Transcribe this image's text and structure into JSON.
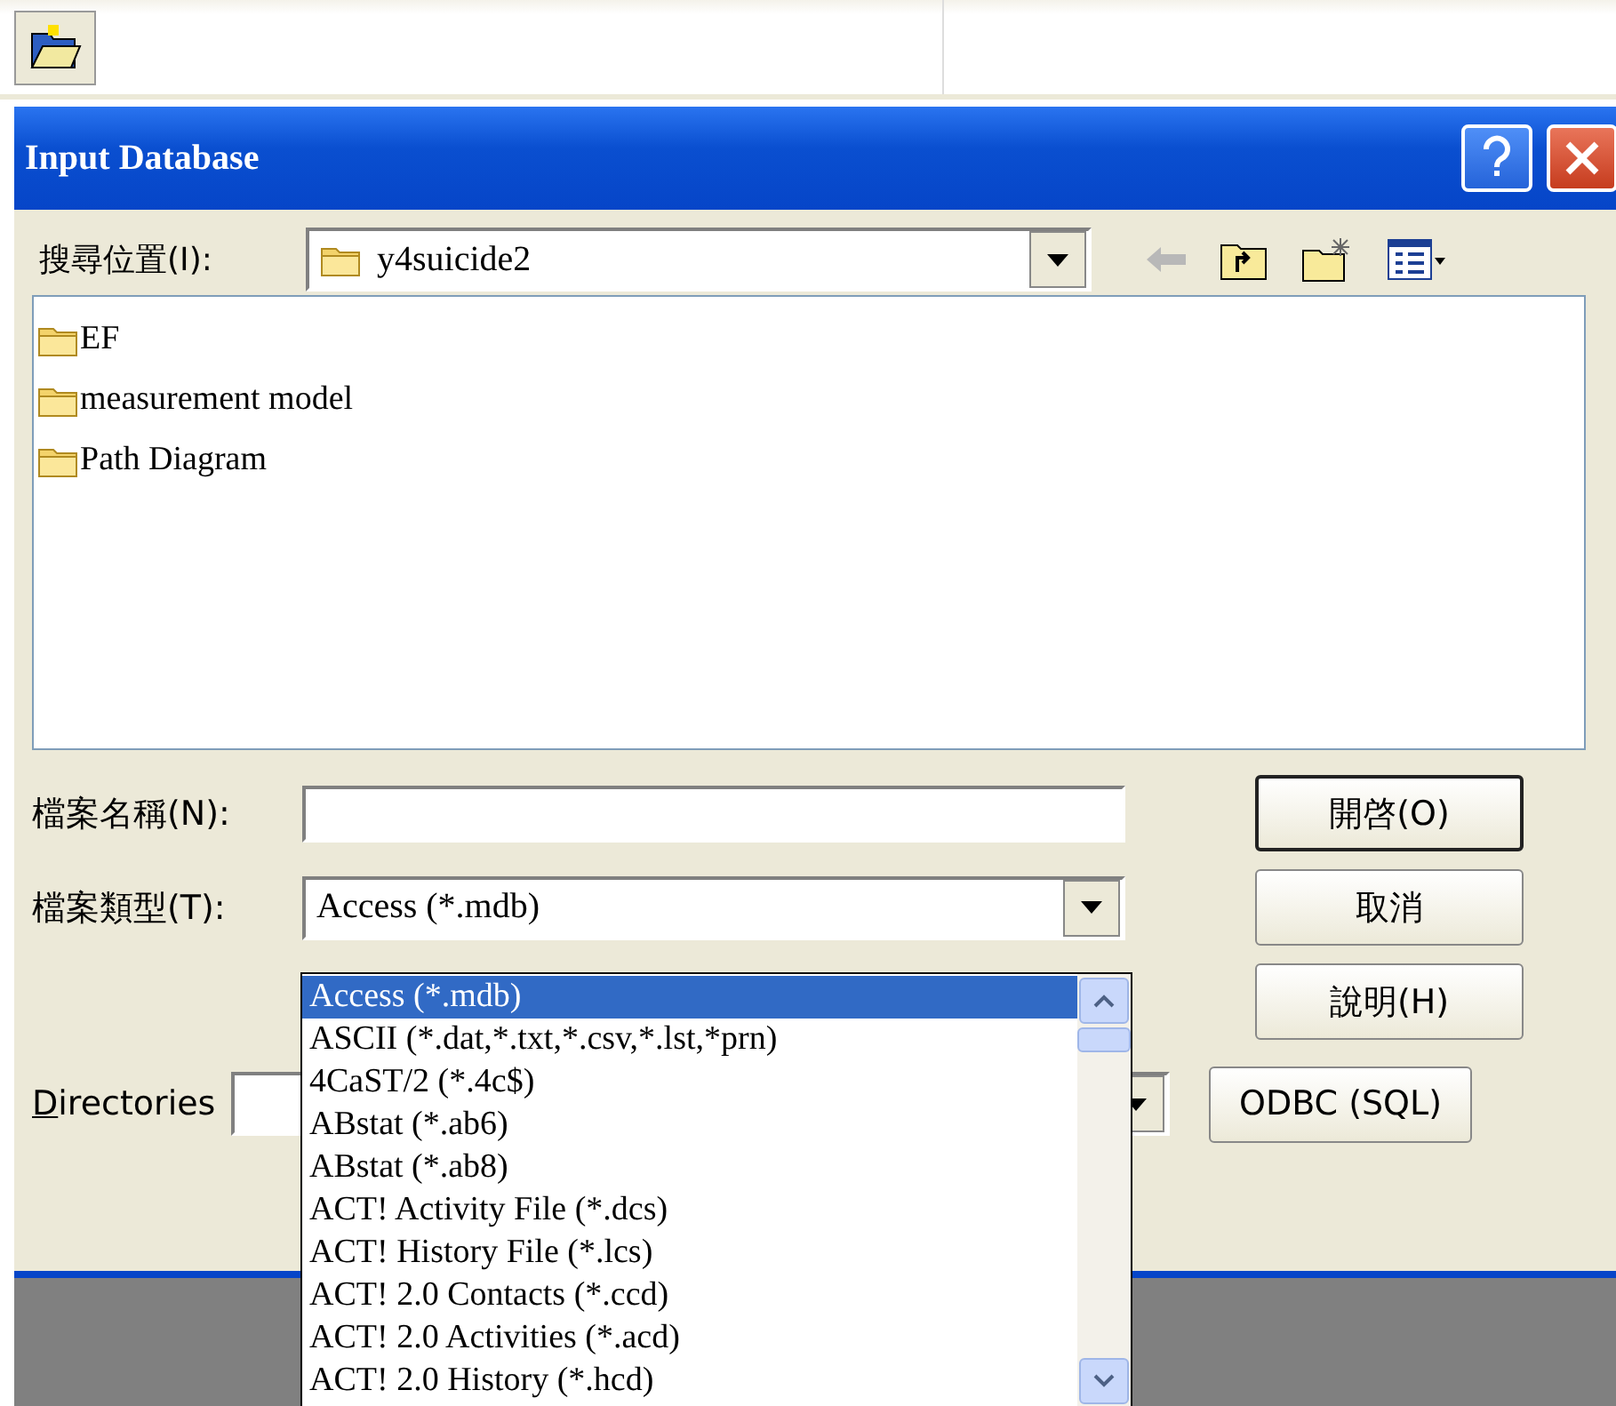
{
  "window": {
    "title": "Input Database"
  },
  "look_in": {
    "label": "搜尋位置(I):",
    "value": "y4suicide2"
  },
  "files": [
    {
      "name": "EF"
    },
    {
      "name": "measurement model"
    },
    {
      "name": "Path Diagram"
    }
  ],
  "file_name": {
    "label": "檔案名稱(N):"
  },
  "file_type": {
    "label": "檔案類型(T):",
    "value": "Access (*.mdb)",
    "expanded": true,
    "options": [
      {
        "label": "Access (*.mdb)",
        "selected": true
      },
      {
        "label": "ASCII (*.dat,*.txt,*.csv,*.lst,*prn)",
        "selected": false
      },
      {
        "label": "4CaST/2 (*.4c$)",
        "selected": false
      },
      {
        "label": "ABstat (*.ab6)",
        "selected": false
      },
      {
        "label": "ABstat (*.ab8)",
        "selected": false
      },
      {
        "label": "ACT! Activity File (*.dcs)",
        "selected": false
      },
      {
        "label": "ACT! History File (*.lcs)",
        "selected": false
      },
      {
        "label": "ACT! 2.0 Contacts (*.ccd)",
        "selected": false
      },
      {
        "label": "ACT! 2.0 Activities (*.acd)",
        "selected": false
      },
      {
        "label": "ACT! 2.0 History (*.hcd)",
        "selected": false
      }
    ]
  },
  "directories": {
    "label": "Directories"
  },
  "buttons": [
    {
      "label": "開啓(O)",
      "default": true
    },
    {
      "label": "取消",
      "default": false
    },
    {
      "label": "說明(H)",
      "default": false
    },
    {
      "label": "ODBC (SQL)",
      "default": false
    }
  ]
}
